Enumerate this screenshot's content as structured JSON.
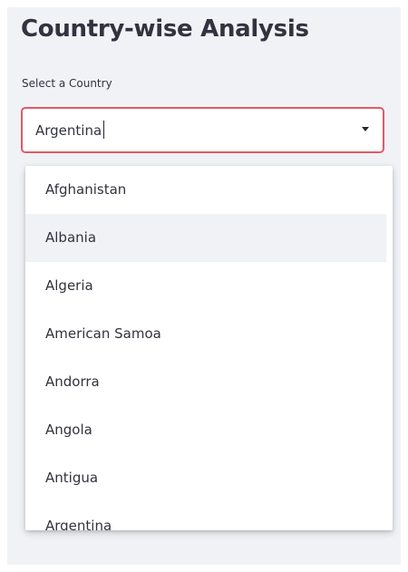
{
  "title": "Country-wise Analysis",
  "select": {
    "label": "Select a Country",
    "value": "Argentina"
  },
  "dropdown": {
    "options": [
      "Afghanistan",
      "Albania",
      "Algeria",
      "American Samoa",
      "Andorra",
      "Angola",
      "Antigua",
      "Argentina"
    ],
    "highlighted_index": 1
  },
  "colors": {
    "focus_border": "#e05a66",
    "highlight_bg": "#f0f2f6",
    "text": "#31333f"
  }
}
